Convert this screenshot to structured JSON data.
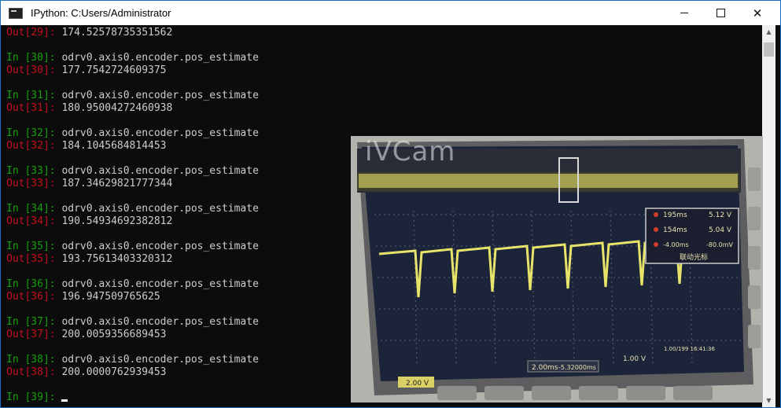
{
  "window": {
    "title": "IPython: C:Users/Administrator",
    "controls": {
      "minimize": "—",
      "maximize": "☐",
      "close": "✕"
    }
  },
  "console": {
    "lines": [
      {
        "prompt": "Out[29]: ",
        "kind": "out",
        "text": "174.52578735351562"
      },
      {
        "prompt": "In [30]: ",
        "kind": "in",
        "text": "odrv0.axis0.encoder.pos_estimate"
      },
      {
        "prompt": "Out[30]: ",
        "kind": "out",
        "text": "177.7542724609375"
      },
      {
        "prompt": "In [31]: ",
        "kind": "in",
        "text": "odrv0.axis0.encoder.pos_estimate"
      },
      {
        "prompt": "Out[31]: ",
        "kind": "out",
        "text": "180.95004272460938"
      },
      {
        "prompt": "In [32]: ",
        "kind": "in",
        "text": "odrv0.axis0.encoder.pos_estimate"
      },
      {
        "prompt": "Out[32]: ",
        "kind": "out",
        "text": "184.1045684814453"
      },
      {
        "prompt": "In [33]: ",
        "kind": "in",
        "text": "odrv0.axis0.encoder.pos_estimate"
      },
      {
        "prompt": "Out[33]: ",
        "kind": "out",
        "text": "187.34629821777344"
      },
      {
        "prompt": "In [34]: ",
        "kind": "in",
        "text": "odrv0.axis0.encoder.pos_estimate"
      },
      {
        "prompt": "Out[34]: ",
        "kind": "out",
        "text": "190.54934692382812"
      },
      {
        "prompt": "In [35]: ",
        "kind": "in",
        "text": "odrv0.axis0.encoder.pos_estimate"
      },
      {
        "prompt": "Out[35]: ",
        "kind": "out",
        "text": "193.75613403320312"
      },
      {
        "prompt": "In [36]: ",
        "kind": "in",
        "text": "odrv0.axis0.encoder.pos_estimate"
      },
      {
        "prompt": "Out[36]: ",
        "kind": "out",
        "text": "196.947509765625"
      },
      {
        "prompt": "In [37]: ",
        "kind": "in",
        "text": "odrv0.axis0.encoder.pos_estimate"
      },
      {
        "prompt": "Out[37]: ",
        "kind": "out",
        "text": "200.0059356689453"
      },
      {
        "prompt": "In [38]: ",
        "kind": "in",
        "text": "odrv0.axis0.encoder.pos_estimate"
      },
      {
        "prompt": "Out[38]: ",
        "kind": "out",
        "text": "200.0000762939453"
      },
      {
        "prompt": "In [39]: ",
        "kind": "in",
        "text": ""
      }
    ],
    "colors": {
      "background": "#0c0c0c",
      "text": "#cccccc",
      "in_prompt": "#13a10e",
      "out_prompt": "#c50f1f"
    }
  },
  "overlay": {
    "watermark": "iVCam",
    "measurements": [
      {
        "left": "195ms",
        "right": "5.12 V"
      },
      {
        "left": "154ms",
        "right": "5.04 V"
      },
      {
        "left": "-4.00ms",
        "right": "-80.0mV"
      }
    ],
    "cursor_label": "联动光标",
    "status_left": "2.00ms",
    "status_mid": "-5.32000ms",
    "status_right": "1.00 V",
    "channel_label": "2.00 V",
    "info_text": "1.00/199 16:41:36"
  }
}
